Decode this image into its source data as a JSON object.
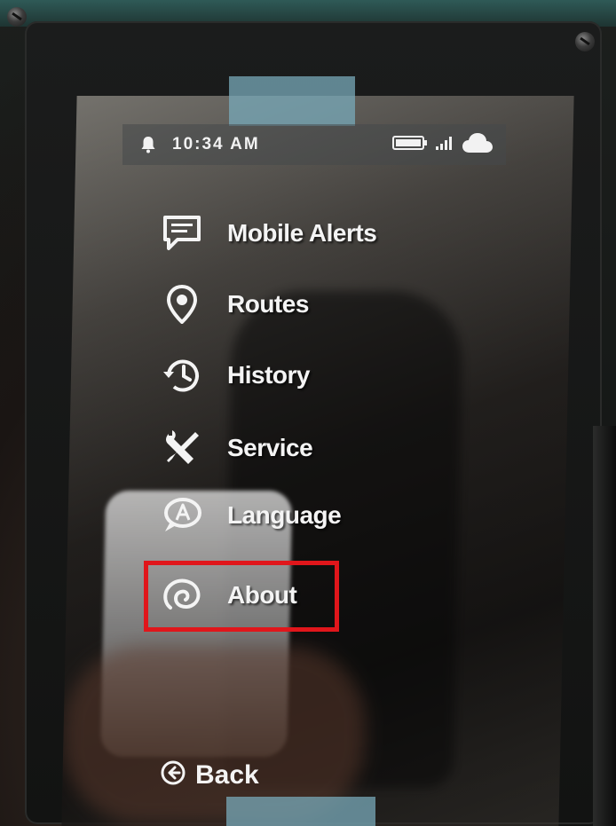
{
  "status_bar": {
    "time": "10:34 AM",
    "icons": [
      "bell-icon",
      "battery-icon",
      "signal-icon",
      "cloud-icon"
    ]
  },
  "menu": {
    "items": [
      {
        "label": "Mobile Alerts",
        "icon": "chat-bubble-icon"
      },
      {
        "label": "Routes",
        "icon": "map-pin-icon"
      },
      {
        "label": "History",
        "icon": "clock-history-icon"
      },
      {
        "label": "Service",
        "icon": "wrench-screwdriver-icon"
      },
      {
        "label": "Language",
        "icon": "speech-bubble-a-icon"
      },
      {
        "label": "About",
        "icon": "info-swirl-icon"
      }
    ],
    "highlighted": "About"
  },
  "back": {
    "label": "Back",
    "icon": "back-arrow-icon"
  },
  "colors": {
    "highlight_border": "#e0161b",
    "text": "#f4f4f4",
    "tape": "#78aab9"
  }
}
